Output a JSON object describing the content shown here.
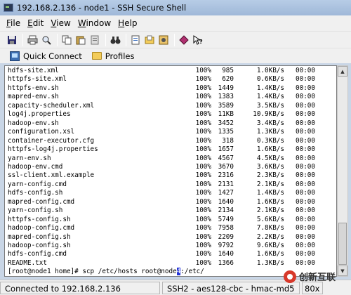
{
  "window": {
    "title": "192.168.2.136 - node1 - SSH Secure Shell"
  },
  "menubar": {
    "items": [
      {
        "label": "File",
        "acc": "F",
        "rest": "ile"
      },
      {
        "label": "Edit",
        "acc": "E",
        "rest": "dit"
      },
      {
        "label": "View",
        "acc": "V",
        "rest": "iew"
      },
      {
        "label": "Window",
        "acc": "W",
        "rest": "indow"
      },
      {
        "label": "Help",
        "acc": "H",
        "rest": "elp"
      }
    ]
  },
  "toolbar": {
    "icons": [
      "save-icon",
      "print-icon",
      "find-icon",
      "copy-icon",
      "paste-icon",
      "paste-alt-icon",
      "binoculars-icon",
      "new-file-icon",
      "open-file-icon",
      "settings-icon",
      "profile-icon",
      "help-icon"
    ]
  },
  "quick_bar": {
    "quick_connect": "Quick Connect",
    "profiles": "Profiles"
  },
  "terminal": {
    "rows": [
      {
        "name": "hdfs-site.xml",
        "pct": "100%",
        "size": "985",
        "rate": "1.0KB/s",
        "eta": "00:00"
      },
      {
        "name": "httpfs-site.xml",
        "pct": "100%",
        "size": "620",
        "rate": "0.6KB/s",
        "eta": "00:00"
      },
      {
        "name": "httpfs-env.sh",
        "pct": "100%",
        "size": "1449",
        "rate": "1.4KB/s",
        "eta": "00:00"
      },
      {
        "name": "mapred-env.sh",
        "pct": "100%",
        "size": "1383",
        "rate": "1.4KB/s",
        "eta": "00:00"
      },
      {
        "name": "capacity-scheduler.xml",
        "pct": "100%",
        "size": "3589",
        "rate": "3.5KB/s",
        "eta": "00:00"
      },
      {
        "name": "log4j.properties",
        "pct": "100%",
        "size": "11KB",
        "rate": "10.9KB/s",
        "eta": "00:00"
      },
      {
        "name": "hadoop-env.sh",
        "pct": "100%",
        "size": "3452",
        "rate": "3.4KB/s",
        "eta": "00:00"
      },
      {
        "name": "configuration.xsl",
        "pct": "100%",
        "size": "1335",
        "rate": "1.3KB/s",
        "eta": "00:00"
      },
      {
        "name": "container-executor.cfg",
        "pct": "100%",
        "size": "318",
        "rate": "0.3KB/s",
        "eta": "00:00"
      },
      {
        "name": "httpfs-log4j.properties",
        "pct": "100%",
        "size": "1657",
        "rate": "1.6KB/s",
        "eta": "00:00"
      },
      {
        "name": "yarn-env.sh",
        "pct": "100%",
        "size": "4567",
        "rate": "4.5KB/s",
        "eta": "00:00"
      },
      {
        "name": "hadoop-env.cmd",
        "pct": "100%",
        "size": "3670",
        "rate": "3.6KB/s",
        "eta": "00:00"
      },
      {
        "name": "ssl-client.xml.example",
        "pct": "100%",
        "size": "2316",
        "rate": "2.3KB/s",
        "eta": "00:00"
      },
      {
        "name": "yarn-config.cmd",
        "pct": "100%",
        "size": "2131",
        "rate": "2.1KB/s",
        "eta": "00:00"
      },
      {
        "name": "hdfs-config.sh",
        "pct": "100%",
        "size": "1427",
        "rate": "1.4KB/s",
        "eta": "00:00"
      },
      {
        "name": "mapred-config.cmd",
        "pct": "100%",
        "size": "1640",
        "rate": "1.6KB/s",
        "eta": "00:00"
      },
      {
        "name": "yarn-config.sh",
        "pct": "100%",
        "size": "2134",
        "rate": "2.1KB/s",
        "eta": "00:00"
      },
      {
        "name": "httpfs-config.sh",
        "pct": "100%",
        "size": "5749",
        "rate": "5.6KB/s",
        "eta": "00:00"
      },
      {
        "name": "hadoop-config.cmd",
        "pct": "100%",
        "size": "7958",
        "rate": "7.8KB/s",
        "eta": "00:00"
      },
      {
        "name": "mapred-config.sh",
        "pct": "100%",
        "size": "2209",
        "rate": "2.2KB/s",
        "eta": "00:00"
      },
      {
        "name": "hadoop-config.sh",
        "pct": "100%",
        "size": "9792",
        "rate": "9.6KB/s",
        "eta": "00:00"
      },
      {
        "name": "hdfs-config.cmd",
        "pct": "100%",
        "size": "1640",
        "rate": "1.6KB/s",
        "eta": "00:00"
      },
      {
        "name": "README.txt",
        "pct": "100%",
        "size": "1366",
        "rate": "1.3KB/s",
        "eta": "00:00"
      }
    ],
    "prompt_before": "[root@node1 home]# scp /etc/hosts root@node",
    "prompt_cursor": "4",
    "prompt_after": ":/etc/"
  },
  "statusbar": {
    "connection": "Connected to 192.168.2.136",
    "cipher": "SSH2 - aes128-cbc - hmac-md5",
    "size": "80x"
  },
  "watermark": {
    "text": "创新互联"
  }
}
